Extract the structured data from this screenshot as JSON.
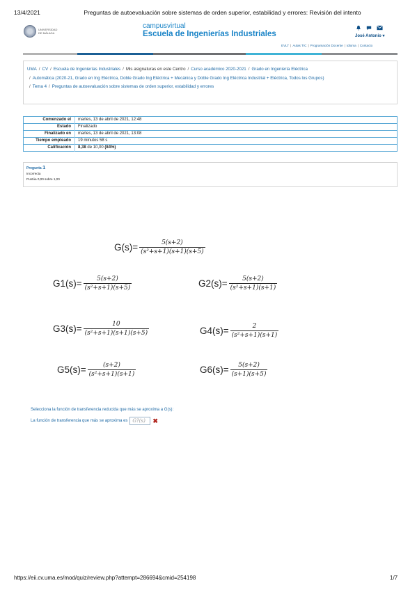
{
  "header": {
    "date": "13/4/2021",
    "doc_title": "Preguntas de autoevaluación sobre sistemas de orden superior, estabilidad y errores: Revisión del intento"
  },
  "site": {
    "logo_text": "UNIVERSIDAD DE MÁLAGA",
    "brand_top": "campusvirtual",
    "brand_bottom": "Escuela de Ingenierías Industriales",
    "user_name": "José Antonio",
    "icons": {
      "notifications": "bell-icon",
      "messages": "chat-icon",
      "mail": "envelope-icon"
    },
    "top_links": [
      "EVLT",
      "Aulas TIC",
      "Programación Docente",
      "Idioma",
      "Contacto"
    ],
    "bar_colors": [
      "#b3b3b3",
      "#1b5f95",
      "#6d6f72",
      "#3fb3d6",
      "#8a8c8f"
    ]
  },
  "breadcrumbs": [
    {
      "label": "UMA",
      "link": true
    },
    {
      "label": "CV",
      "link": true
    },
    {
      "label": "Escuela de Ingenierías Industriales",
      "link": true
    },
    {
      "label": "Mis asignaturas en este Centro",
      "link": false
    },
    {
      "label": "Curso académico 2020-2021",
      "link": true
    },
    {
      "label": "Grado en Ingeniería Eléctrica",
      "link": true
    },
    {
      "label": "Automática (2020-21, Grado en Ing Eléctrica, Doble Grado Ing Eléctrica + Mecánica y Doble Grado Ing Eléctrica Industrial + Eléctrica, Todos los Grupos)",
      "link": true
    },
    {
      "label": "Tema 4",
      "link": true
    },
    {
      "label": "Preguntas de autoevaluación sobre sistemas de orden superior, estabilidad y errores",
      "link": true
    }
  ],
  "summary": [
    {
      "label": "Comenzado el",
      "value": "martes, 13 de abril de 2021, 12:48"
    },
    {
      "label": "Estado",
      "value": "Finalizado"
    },
    {
      "label": "Finalizado en",
      "value": "martes, 13 de abril de 2021, 13:08"
    },
    {
      "label": "Tiempo empleado",
      "value": "19 minutos 58 s"
    },
    {
      "label": "Calificación",
      "value_bold": "8,38",
      "value": " de 10,00 ",
      "value_pct": "(84%)"
    }
  ],
  "question": {
    "label": "Pregunta",
    "number": "1",
    "status": "Incorrecta",
    "score": "Puntúa 0,00 sobre 1,00"
  },
  "formulas": {
    "G": {
      "name": "G(s)=",
      "num": "5(s+2)",
      "den": "(s²+s+1)(s+1)(s+5)"
    },
    "G1": {
      "name": "G1(s)=",
      "num": "5(s+2)",
      "den": "(s²+s+1)(s+5)"
    },
    "G2": {
      "name": "G2(s)=",
      "num": "5(s+2)",
      "den": "(s²+s+1)(s+1)"
    },
    "G3": {
      "name": "G3(s)=",
      "num": "10",
      "den": "(s²+s+1)(s+1)(s+5)"
    },
    "G4": {
      "name": "G4(s)=",
      "num": "2",
      "den": "(s²+s+1)(s+1)"
    },
    "G5": {
      "name": "G5(s)=",
      "num": "(s+2)",
      "den": "(s²+s+1)(s+1)"
    },
    "G6": {
      "name": "G6(s)=",
      "num": "5(s+2)",
      "den": "(s+1)(s+5)"
    }
  },
  "prompt": "Selecciona la función de transferencia reducida que más se aproxima a G(s):",
  "answer": {
    "label": "La función de transferencia que más se aproxima es",
    "value": "G?(s)",
    "status_icon": "cross-icon"
  },
  "footer": {
    "url": "https://eii.cv.uma.es/mod/quiz/review.php?attempt=286694&cmid=254198",
    "page": "1/7"
  }
}
